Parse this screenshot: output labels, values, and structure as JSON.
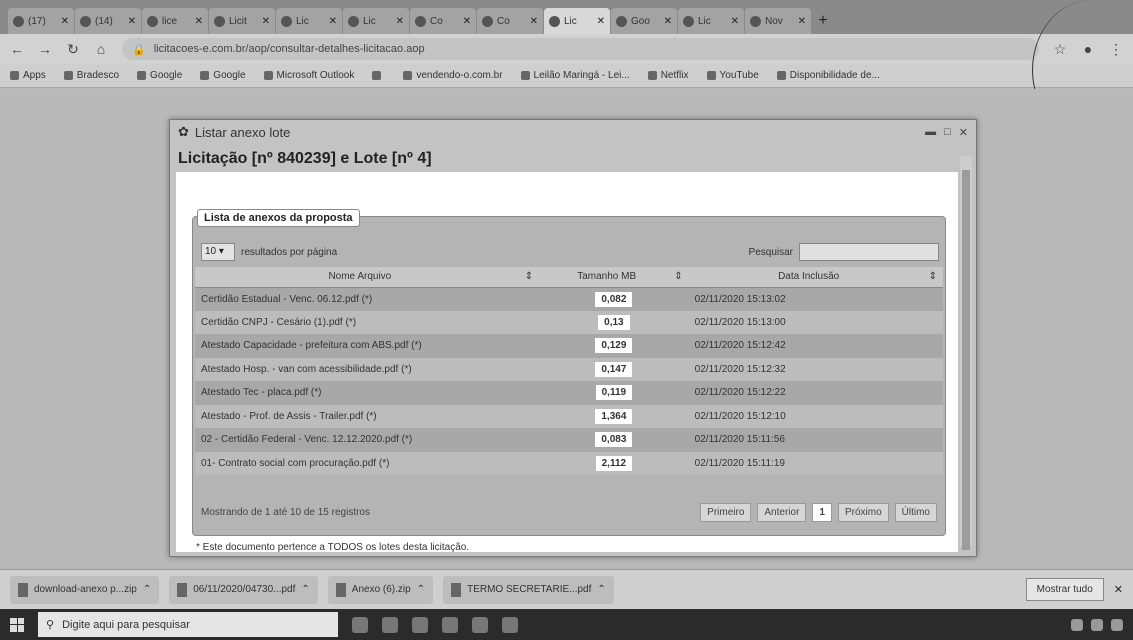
{
  "browser": {
    "tabs": [
      {
        "label": "(17)",
        "active": false
      },
      {
        "label": "(14)",
        "active": false
      },
      {
        "label": "lice",
        "active": false
      },
      {
        "label": "Licit",
        "active": false
      },
      {
        "label": "Lic",
        "active": false
      },
      {
        "label": "Lic",
        "active": false
      },
      {
        "label": "Co",
        "active": false
      },
      {
        "label": "Co",
        "active": false
      },
      {
        "label": "Lic",
        "active": true
      },
      {
        "label": "Goo",
        "active": false
      },
      {
        "label": "Lic",
        "active": false
      },
      {
        "label": "Nov",
        "active": false
      }
    ],
    "url": "licitacoes-e.com.br/aop/consultar-detalhes-licitacao.aop",
    "bookmarks": [
      "Apps",
      "Bradesco",
      "Google",
      "Google",
      "Microsoft Outlook",
      "",
      "vendendo-o.com.br",
      "Leilão Maringá - Lei...",
      "Netflix",
      "YouTube",
      "Disponibilidade de..."
    ]
  },
  "modal": {
    "title": "Listar anexo lote",
    "heading": "Licitação [nº 840239] e Lote [nº 4]",
    "panel_title": "Lista de anexos da proposta",
    "page_size": "10",
    "per_page_label": "resultados por página",
    "search_label": "Pesquisar",
    "columns": [
      "Nome Arquivo",
      "Tamanho MB",
      "Data Inclusão"
    ],
    "rows": [
      {
        "name": "Certidão Estadual - Venc. 06.12.pdf (*)",
        "size": "0,082",
        "date": "02/11/2020 15:13:02"
      },
      {
        "name": "Certidão CNPJ - Cesário (1).pdf (*)",
        "size": "0,13",
        "date": "02/11/2020 15:13:00"
      },
      {
        "name": "Atestado Capacidade - prefeitura com ABS.pdf (*)",
        "size": "0,129",
        "date": "02/11/2020 15:12:42"
      },
      {
        "name": "Atestado Hosp. - van com acessibilidade.pdf (*)",
        "size": "0,147",
        "date": "02/11/2020 15:12:32"
      },
      {
        "name": "Atestado Tec - placa.pdf (*)",
        "size": "0,119",
        "date": "02/11/2020 15:12:22"
      },
      {
        "name": "Atestado - Prof. de Assis - Trailer.pdf (*)",
        "size": "1,364",
        "date": "02/11/2020 15:12:10"
      },
      {
        "name": "02 - Certidão Federal - Venc. 12.12.2020.pdf (*)",
        "size": "0,083",
        "date": "02/11/2020 15:11:56"
      },
      {
        "name": "01- Contrato social com procuração.pdf (*)",
        "size": "2,112",
        "date": "02/11/2020 15:11:19"
      }
    ],
    "footer_text": "Mostrando de 1 até 10 de 15 registros",
    "pager": [
      "Primeiro",
      "Anterior",
      "1",
      "Próximo",
      "Último"
    ],
    "note": "* Este documento pertence a TODOS os lotes desta licitação."
  },
  "downloads": [
    "download-anexo p...zip",
    "06/11/2020/04730...pdf",
    "Anexo (6).zip",
    "TERMO SECRETARIE...pdf"
  ],
  "downloads_show_all": "Mostrar tudo",
  "taskbar": {
    "search_placeholder": "Digite aqui para pesquisar"
  }
}
